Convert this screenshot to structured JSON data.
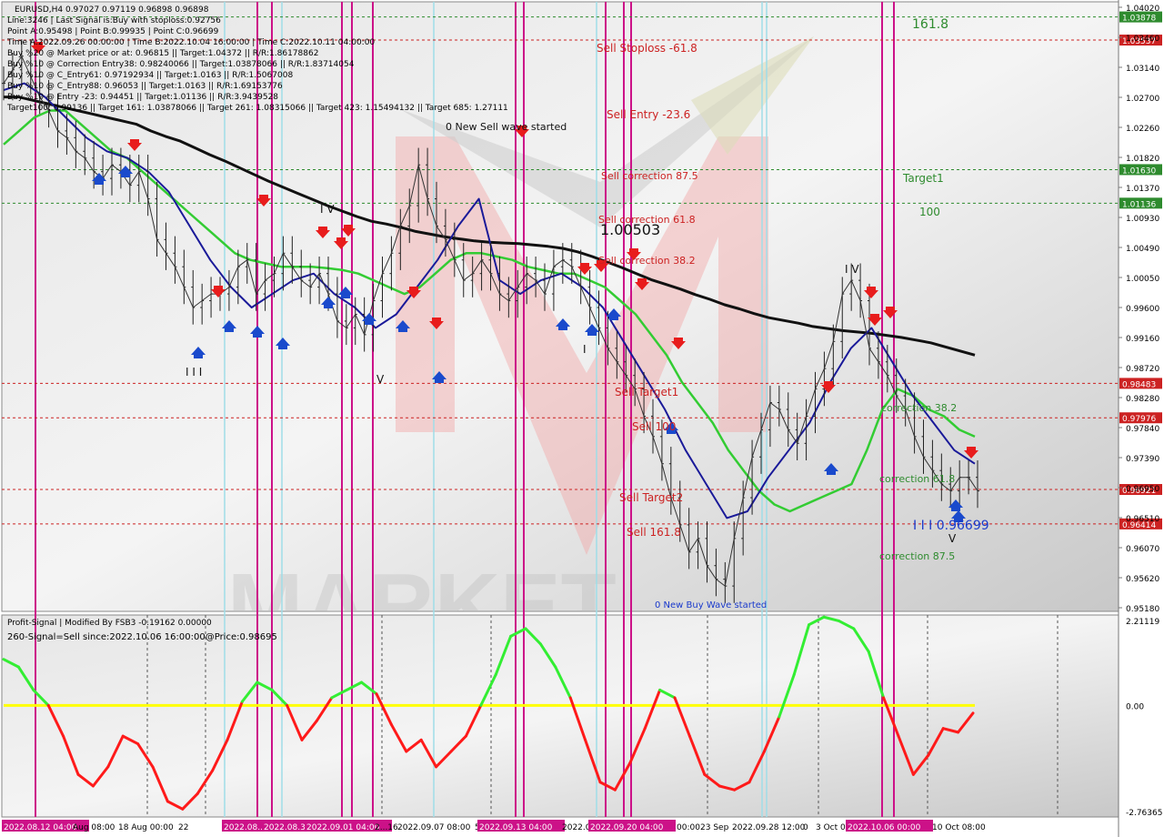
{
  "header": {
    "symbol_line": "EURUSD,H4  0.97027 0.97119 0.96898 0.96898",
    "info_lines": [
      "Line:3246 | Last Signal is:Buy with stoploss:0.92756",
      "Point A:0.95498 | Point B:0.99935 | Point C:0.96699",
      "Time A:2022.09.26 00:00:00 | Time B:2022.10.04 16:00:00 | Time C:2022.10.11 04:00:00",
      "Buy %20 @ Market price or at: 0.96815 || Target:1.04372 || R/R:1.86178862",
      "Buy %10 @ Correction Entry38: 0.98240066 || Target:1.03878066 || R/R:1.83714054",
      "Buy %10 @ C_Entry61: 0.97192934 || Target:1.0163 || R/R:1.5067008",
      "Buy %10 @ C_Entry88: 0.96053 || Target:1.0163 || R/R:1.69153776",
      "Buy %10 @ Entry -23: 0.94451 || Target:1.01136 || R/R:3.9439528",
      "Target100: 0.99136 || Target 161: 1.03878066 || Target 261: 1.08315066 || Target 423: 1.15494132 || Target 685: 1.27111"
    ]
  },
  "indicator": {
    "title_line": "Profit-Signal | Modified By FSB3 -0.19162 0.00000",
    "signal_line": "260-Signal=Sell since:2022.10.06 16:00:00@Price:0.98695"
  },
  "chart_data": {
    "type": "line",
    "symbol": "EURUSD",
    "timeframe": "H4",
    "ohlc_last": {
      "open": 0.97027,
      "high": 0.97119,
      "low": 0.96898,
      "close": 0.96898
    },
    "ylim": [
      0.9518,
      1.0402
    ],
    "y_ticks": [
      "1.04020",
      "1.03460",
      "1.03140",
      "1.02700",
      "1.02260",
      "1.01820",
      "1.01370",
      "1.00930",
      "1.00490",
      "1.00050",
      "0.99600",
      "0.99160",
      "0.98720",
      "0.98280",
      "0.97840",
      "0.97390",
      "0.96950",
      "0.96510",
      "0.96070",
      "0.95620",
      "0.95180"
    ],
    "x_ticks": [
      "2022.08.12 04:00",
      "Aug 08:00",
      "18 Aug 00:00",
      "22",
      "2022.08...",
      "2022.08.30...",
      "2022.09.01 04:00",
      "2...16",
      "2022.09.07 08:00",
      "5",
      "2022.09.13 04:00",
      "2022.09...",
      "2022.09.20 04:00",
      "00:00",
      "23 Sep",
      "2022.09.28 12:00",
      "0",
      "3 Oct 0",
      "2022.10.06 00:00",
      "10 Oct 08:00"
    ],
    "price_levels": [
      {
        "label": "161.8",
        "value": 1.03878,
        "badge": "1.03878",
        "color": "#2e8b2e"
      },
      {
        "label": "Sell Stoploss -61.8",
        "value": 1.03537,
        "badge": "1.03537",
        "color": "#cc2222"
      },
      {
        "label": "Target1",
        "value": 1.0163,
        "badge": "1.01630",
        "color": "#2e8b2e"
      },
      {
        "label": "100",
        "value": 1.01136,
        "badge": "1.01136",
        "color": "#2e8b2e"
      },
      {
        "label": "",
        "value": 0.98483,
        "badge": "0.98483",
        "color": "#cc2222"
      },
      {
        "label": "",
        "value": 0.97976,
        "badge": "0.97976",
        "color": "#cc2222"
      },
      {
        "label": "",
        "value": 0.96921,
        "badge": "0.96921",
        "color": "#cc2222"
      },
      {
        "label": "",
        "value": 0.96414,
        "badge": "0.96414",
        "color": "#cc2222"
      }
    ],
    "chart_labels": [
      {
        "text": "Sell Entry -23.6",
        "color": "#cc2222"
      },
      {
        "text": "0 New Sell wave started",
        "color": "#111111"
      },
      {
        "text": "Sell correction 87.5",
        "color": "#cc2222"
      },
      {
        "text": "Sell correction 61.8",
        "color": "#cc2222"
      },
      {
        "text": "1.00503",
        "color": "#111111"
      },
      {
        "text": "Sell correction 38.2",
        "color": "#cc2222"
      },
      {
        "text": "Sell Target1",
        "color": "#cc2222"
      },
      {
        "text": "Sell 100",
        "color": "#cc2222"
      },
      {
        "text": "Sell Target2",
        "color": "#cc2222"
      },
      {
        "text": "Sell 161.8",
        "color": "#cc2222"
      },
      {
        "text": "0 New Buy Wave started",
        "color": "#1a3acc"
      },
      {
        "text": "correction 38.2",
        "color": "#2e8b2e"
      },
      {
        "text": "correction 61.8",
        "color": "#2e8b2e"
      },
      {
        "text": "correction 87.5",
        "color": "#2e8b2e"
      },
      {
        "text": "I I I 0.96699",
        "color": "#1a3acc"
      },
      {
        "text": "I V",
        "color": "#111111"
      },
      {
        "text": "I I I",
        "color": "#111111"
      },
      {
        "text": "V",
        "color": "#111111"
      },
      {
        "text": "I V",
        "color": "#111111"
      },
      {
        "text": "I",
        "color": "#111111"
      },
      {
        "text": "V",
        "color": "#111111"
      }
    ],
    "series": [
      {
        "name": "Close",
        "color": "#000000",
        "values": [
          1.029,
          1.031,
          1.033,
          1.03,
          1.027,
          1.025,
          1.022,
          1.021,
          1.019,
          1.018,
          1.016,
          1.015,
          1.017,
          1.016,
          1.014,
          1.016,
          1.012,
          1.006,
          1.004,
          1.002,
          0.999,
          0.996,
          0.997,
          0.998,
          0.998,
          0.999,
          1.002,
          1.003,
          0.998,
          1.0,
          1.001,
          1.004,
          1.002,
          1.0,
          0.999,
          1.001,
          0.998,
          0.994,
          0.993,
          0.995,
          0.992,
          0.997,
          1.001,
          1.004,
          1.008,
          1.011,
          1.017,
          1.012,
          1.008,
          1.006,
          1.003,
          1.0,
          1.001,
          1.003,
          1.001,
          0.998,
          0.997,
          0.999,
          1.001,
          1.0,
          0.998,
          1.002,
          1.003,
          1.002,
          0.999,
          0.996,
          0.993,
          0.99,
          0.988,
          0.986,
          0.984,
          0.98,
          0.977,
          0.973,
          0.968,
          0.964,
          0.96,
          0.962,
          0.958,
          0.956,
          0.955,
          0.962,
          0.968,
          0.974,
          0.978,
          0.982,
          0.981,
          0.978,
          0.976,
          0.98,
          0.984,
          0.987,
          0.991,
          0.998,
          1.0,
          0.997,
          0.99,
          0.988,
          0.986,
          0.983,
          0.981,
          0.977,
          0.974,
          0.972,
          0.97,
          0.969,
          0.971,
          0.971,
          0.969
        ]
      },
      {
        "name": "MA-slow",
        "color": "#111111",
        "values": [
          1.027,
          1.027,
          1.0265,
          1.026,
          1.0255,
          1.025,
          1.0245,
          1.024,
          1.0235,
          1.023,
          1.022,
          1.0212,
          1.0205,
          1.0195,
          1.0185,
          1.0176,
          1.0166,
          1.0156,
          1.0146,
          1.0137,
          1.0128,
          1.0119,
          1.011,
          1.0102,
          1.0094,
          1.0087,
          1.0083,
          1.0078,
          1.0072,
          1.0068,
          1.0064,
          1.0061,
          1.0058,
          1.0056,
          1.0055,
          1.0054,
          1.0052,
          1.005,
          1.0047,
          1.0042,
          1.0035,
          1.0027,
          1.0019,
          1.001,
          1.0001,
          0.9994,
          0.9987,
          0.9979,
          0.9972,
          0.9964,
          0.9958,
          0.9951,
          0.9945,
          0.9941,
          0.9937,
          0.9932,
          0.9929,
          0.9926,
          0.9924,
          0.9922,
          0.9919,
          0.9916,
          0.9912,
          0.9908,
          0.9902,
          0.9896,
          0.989
        ]
      },
      {
        "name": "MA-green",
        "color": "#33cc33",
        "values": [
          1.02,
          1.022,
          1.024,
          1.025,
          1.025,
          1.023,
          1.021,
          1.019,
          1.018,
          1.016,
          1.014,
          1.012,
          1.01,
          1.008,
          1.006,
          1.004,
          1.003,
          1.0025,
          1.002,
          1.002,
          1.002,
          1.0018,
          1.0015,
          1.001,
          1.0,
          0.999,
          0.998,
          0.999,
          1.001,
          1.003,
          1.004,
          1.004,
          1.0035,
          1.003,
          1.002,
          1.0015,
          1.001,
          1.001,
          1.0,
          0.999,
          0.997,
          0.995,
          0.992,
          0.989,
          0.985,
          0.982,
          0.979,
          0.975,
          0.972,
          0.969,
          0.967,
          0.966,
          0.967,
          0.968,
          0.969,
          0.97,
          0.975,
          0.981,
          0.984,
          0.983,
          0.981,
          0.98,
          0.978,
          0.977
        ]
      },
      {
        "name": "MA-blue",
        "color": "#1a1a99",
        "values": [
          1.028,
          1.029,
          1.027,
          1.024,
          1.021,
          1.019,
          1.018,
          1.016,
          1.013,
          1.008,
          1.003,
          0.999,
          0.996,
          0.998,
          1.0,
          1.001,
          0.998,
          0.996,
          0.993,
          0.995,
          0.999,
          1.003,
          1.008,
          1.012,
          1.0,
          0.998,
          1.0,
          1.001,
          0.999,
          0.996,
          0.991,
          0.986,
          0.981,
          0.975,
          0.97,
          0.965,
          0.966,
          0.971,
          0.975,
          0.979,
          0.985,
          0.99,
          0.993,
          0.988,
          0.983,
          0.979,
          0.975,
          0.973
        ]
      },
      {
        "name": "Profit-Signal",
        "color": "#ff0000",
        "range": [
          -2.76365,
          2.21119
        ],
        "values": [
          1.2,
          1.0,
          0.4,
          0.0,
          -0.8,
          -1.8,
          -2.1,
          -1.6,
          -0.8,
          -1.0,
          -1.6,
          -2.5,
          -2.7,
          -2.3,
          -1.7,
          -0.9,
          0.1,
          0.6,
          0.4,
          0.0,
          -0.9,
          -0.4,
          0.2,
          0.4,
          0.6,
          0.3,
          -0.5,
          -1.2,
          -0.9,
          -1.6,
          -1.2,
          -0.8,
          0.0,
          0.8,
          1.8,
          2.0,
          1.6,
          1.0,
          0.2,
          -0.9,
          -2.0,
          -2.2,
          -1.5,
          -0.6,
          0.4,
          0.2,
          -0.8,
          -1.8,
          -2.1,
          -2.2,
          -2.0,
          -1.2,
          -0.3,
          0.8,
          2.1,
          2.3,
          2.2,
          2.0,
          1.4,
          0.2,
          -0.8,
          -1.8,
          -1.3,
          -0.6,
          -0.7,
          -0.2
        ]
      }
    ],
    "yellow_zero_line": 0.0,
    "indicator_ticks": [
      "2.21119",
      "0.00",
      "-2.76365"
    ],
    "watermark": "MARKET"
  }
}
